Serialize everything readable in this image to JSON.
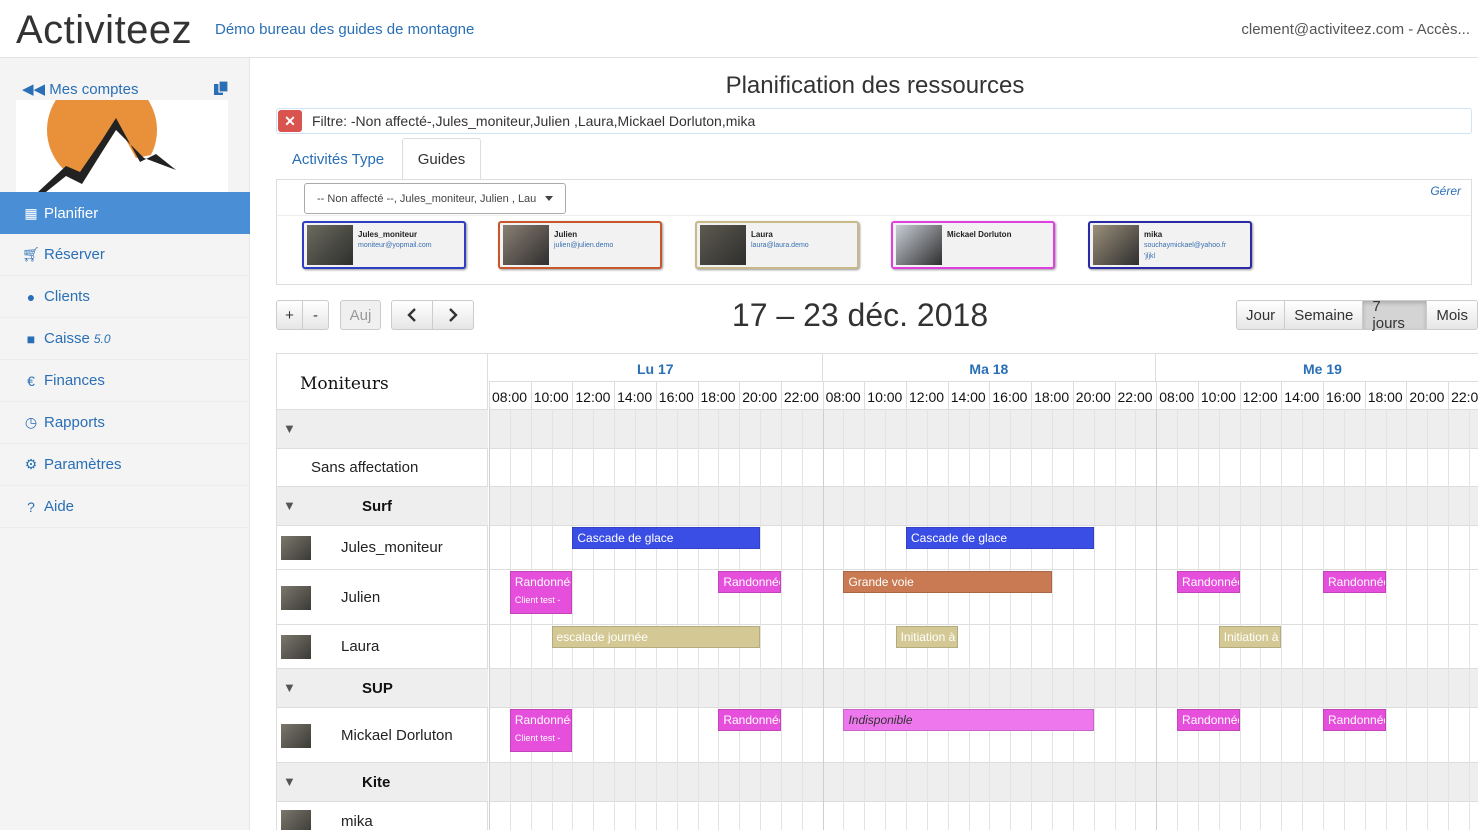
{
  "header": {
    "brand": "Activiteez",
    "org_name": "Démo bureau des guides de montagne",
    "account": "clement@activiteez.com - Accès..."
  },
  "sidebar": {
    "mes_comptes": "Mes comptes",
    "items": [
      {
        "label": "Planifier",
        "icon": "calendar-icon",
        "active": true
      },
      {
        "label": "Réserver",
        "icon": "cart-icon"
      },
      {
        "label": "Clients",
        "icon": "user-icon"
      },
      {
        "label": "Caisse",
        "icon": "register-icon",
        "version": "5.0"
      },
      {
        "label": "Finances",
        "icon": "euro-icon"
      },
      {
        "label": "Rapports",
        "icon": "clock-icon"
      },
      {
        "label": "Paramètres",
        "icon": "gear-icon"
      },
      {
        "label": "Aide",
        "icon": "help-icon"
      }
    ]
  },
  "main": {
    "title": "Planification des ressources",
    "filter_text": "Filtre: -Non affecté-,Jules_moniteur,Julien ,Laura,Mickael Dorluton,mika",
    "tabs": [
      "Activités Type",
      "Guides"
    ],
    "guide_select": "-- Non affecté --, Jules_moniteur, Julien , Lau",
    "gerer": "Gérer",
    "guides": [
      {
        "name": "Jules_moniteur",
        "email": "moniteur@yopmail.com",
        "extra": "",
        "color": "#2f3fc4"
      },
      {
        "name": "Julien",
        "email": "julien@julien.demo",
        "extra": "",
        "color": "#c9572a"
      },
      {
        "name": "Laura",
        "email": "laura@laura.demo",
        "extra": "",
        "color": "#c8b988"
      },
      {
        "name": "Mickael Dorluton",
        "email": "",
        "extra": "",
        "color": "#e040e0"
      },
      {
        "name": "mika",
        "email": "souchaymickael@yahoo.fr",
        "extra": "'jljkl",
        "color": "#2a2aa8"
      }
    ]
  },
  "toolbar": {
    "zoom_in": "+",
    "zoom_out": "-",
    "today": "Auj",
    "prev": "<",
    "next": ">",
    "range": "17 – 23 déc. 2018",
    "views": [
      "Jour",
      "Semaine",
      "7 jours",
      "Mois"
    ],
    "active_view": "7 jours"
  },
  "scheduler": {
    "resource_header": "Moniteurs",
    "days": [
      "Lu 17",
      "Ma 18",
      "Me 19"
    ],
    "hours": [
      "08:00",
      "10:00",
      "12:00",
      "14:00",
      "16:00",
      "18:00",
      "20:00",
      "22:00"
    ],
    "rows": [
      {
        "type": "group",
        "label": ""
      },
      {
        "type": "resource",
        "label": "Sans affectation",
        "thumb": false
      },
      {
        "type": "group",
        "label": "Surf"
      },
      {
        "type": "resource",
        "label": "Jules_moniteur",
        "thumb": true
      },
      {
        "type": "resource",
        "label": "Julien",
        "thumb": true
      },
      {
        "type": "resource",
        "label": "Laura",
        "thumb": true
      },
      {
        "type": "group",
        "label": "SUP"
      },
      {
        "type": "resource",
        "label": "Mickael Dorluton",
        "thumb": true
      },
      {
        "type": "group",
        "label": "Kite"
      },
      {
        "type": "resource",
        "label": "mika",
        "thumb": true
      }
    ],
    "events": [
      {
        "row": 3,
        "day": 0,
        "start": 12.0,
        "end": 21.0,
        "title": "Cascade de glace",
        "sub": "",
        "color": "#3a4ee6",
        "italic": false
      },
      {
        "row": 3,
        "day": 1,
        "start": 12.0,
        "end": 21.0,
        "title": "Cascade de glace",
        "sub": "",
        "color": "#3a4ee6",
        "italic": false
      },
      {
        "row": 4,
        "day": 0,
        "start": 9.0,
        "end": 12.0,
        "title": "Randonnée",
        "sub": "Client test -",
        "color": "#e64fdc",
        "italic": false
      },
      {
        "row": 4,
        "day": 0,
        "start": 19.0,
        "end": 22.0,
        "title": "Randonnée",
        "sub": "",
        "color": "#e64fdc",
        "italic": false
      },
      {
        "row": 4,
        "day": 1,
        "start": 9.0,
        "end": 19.0,
        "title": "Grande voie",
        "sub": "",
        "color": "#c97a52",
        "italic": false
      },
      {
        "row": 4,
        "day": 2,
        "start": 9.0,
        "end": 12.0,
        "title": "Randonnée",
        "sub": "",
        "color": "#e64fdc",
        "italic": false
      },
      {
        "row": 4,
        "day": 2,
        "start": 16.0,
        "end": 19.0,
        "title": "Randonnée",
        "sub": "",
        "color": "#e64fdc",
        "italic": false
      },
      {
        "row": 5,
        "day": 0,
        "start": 11.0,
        "end": 21.0,
        "title": "escalade journée",
        "sub": "",
        "color": "#d4c994",
        "italic": false
      },
      {
        "row": 5,
        "day": 1,
        "start": 11.5,
        "end": 14.5,
        "title": "Initiation à",
        "sub": "",
        "color": "#d4c994",
        "italic": false
      },
      {
        "row": 5,
        "day": 2,
        "start": 11.0,
        "end": 14.0,
        "title": "Initiation à",
        "sub": "",
        "color": "#d4c994",
        "italic": false
      },
      {
        "row": 7,
        "day": 0,
        "start": 9.0,
        "end": 12.0,
        "title": "Randonnée",
        "sub": "Client test -",
        "color": "#e64fdc",
        "italic": false
      },
      {
        "row": 7,
        "day": 0,
        "start": 19.0,
        "end": 22.0,
        "title": "Randonnée",
        "sub": "",
        "color": "#e64fdc",
        "italic": false
      },
      {
        "row": 7,
        "day": 1,
        "start": 9.0,
        "end": 21.0,
        "title": "Indisponible",
        "sub": "",
        "color": "#ee77ee",
        "italic": true
      },
      {
        "row": 7,
        "day": 2,
        "start": 9.0,
        "end": 12.0,
        "title": "Randonnée",
        "sub": "",
        "color": "#e64fdc",
        "italic": false
      },
      {
        "row": 7,
        "day": 2,
        "start": 16.0,
        "end": 19.0,
        "title": "Randonnée",
        "sub": "",
        "color": "#e64fdc",
        "italic": false
      }
    ]
  }
}
